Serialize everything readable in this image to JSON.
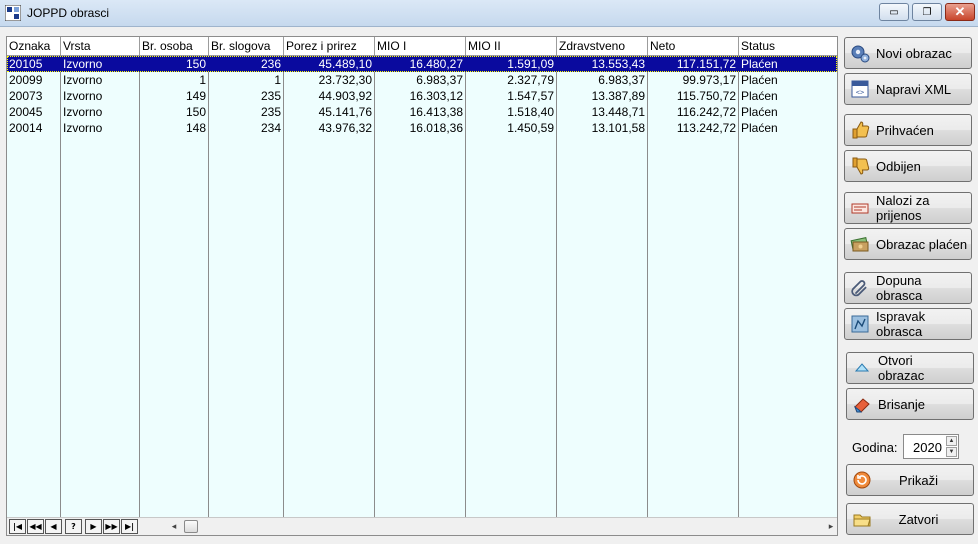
{
  "window": {
    "title": "JOPPD obrasci",
    "minimize_label": "▭",
    "restore_label": "❐",
    "close_label": "✕"
  },
  "grid": {
    "columns": [
      "Oznaka",
      "Vrsta",
      "Br. osoba",
      "Br. slogova",
      "Porez i prirez",
      "MIO I",
      "MIO II",
      "Zdravstveno",
      "Neto",
      "Status"
    ],
    "rows": [
      [
        "20105",
        "Izvorno",
        "150",
        "236",
        "45.489,10",
        "16.480,27",
        "1.591,09",
        "13.553,43",
        "117.151,72",
        "Plaćen"
      ],
      [
        "20099",
        "Izvorno",
        "1",
        "1",
        "23.732,30",
        "6.983,37",
        "2.327,79",
        "6.983,37",
        "99.973,17",
        "Plaćen"
      ],
      [
        "20073",
        "Izvorno",
        "149",
        "235",
        "44.903,92",
        "16.303,12",
        "1.547,57",
        "13.387,89",
        "115.750,72",
        "Plaćen"
      ],
      [
        "20045",
        "Izvorno",
        "150",
        "235",
        "45.141,76",
        "16.413,38",
        "1.518,40",
        "13.448,71",
        "116.242,72",
        "Plaćen"
      ],
      [
        "20014",
        "Izvorno",
        "148",
        "234",
        "43.976,32",
        "16.018,36",
        "1.450,59",
        "13.101,58",
        "113.242,72",
        "Plaćen"
      ]
    ],
    "selected_row": 0
  },
  "navigator": {
    "first": "|◀",
    "prev_page": "◀◀",
    "prev": "◀",
    "help": "?",
    "next": "▶",
    "next_page": "▶▶",
    "last": "▶|",
    "scroll_left": "◂",
    "scroll_right": "▸"
  },
  "buttons": {
    "novi_obrazac": "Novi obrazac",
    "napravi_xml": "Napravi XML",
    "prihvacen": "Prihvaćen",
    "odbijen": "Odbijen",
    "nalozi_line1": "Nalozi za",
    "nalozi_line2": "prijenos",
    "obrazac_placen": "Obrazac plaćen",
    "dopuna_line1": "Dopuna",
    "dopuna_line2": "obrasca",
    "ispravak_line1": "Ispravak",
    "ispravak_line2": "obrasca",
    "otvori_line1": "Otvori",
    "otvori_line2": "obrazac",
    "brisanje": "Brisanje",
    "prikazi": "Prikaži",
    "zatvori": "Zatvori"
  },
  "godina": {
    "label": "Godina:",
    "value": "2020"
  },
  "icons": {
    "novi_obrazac": "gears-icon",
    "napravi_xml": "xml-file-icon",
    "prihvacen": "thumbs-up-icon",
    "odbijen": "thumbs-down-icon",
    "nalozi": "payment-slip-icon",
    "obrazac_placen": "money-icon",
    "dopuna": "paperclip-icon",
    "ispravak": "document-edit-icon",
    "otvori": "eject-icon",
    "brisanje": "eraser-icon",
    "prikazi": "refresh-icon",
    "zatvori": "folder-icon"
  },
  "colors": {
    "grid_background": "#eefefe",
    "selection": "#0a0a9e",
    "titlebar": "#c6d9ee"
  }
}
